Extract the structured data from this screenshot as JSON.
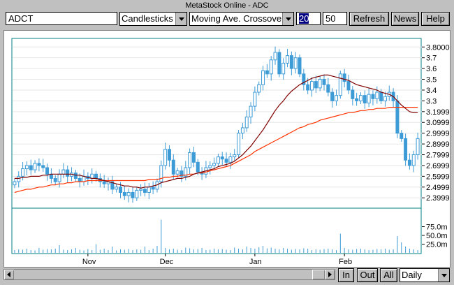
{
  "window": {
    "title": "MetaStock Online - ADC"
  },
  "toolbar": {
    "symbol": "ADCT",
    "chart_type": "Candlesticks",
    "indicator": "Moving Ave. Crossover",
    "param1": "20",
    "param2": "50",
    "refresh_label": "Refresh",
    "news_label": "News",
    "help_label": "Help"
  },
  "bottom": {
    "in_label": "In",
    "out_label": "Out",
    "all_label": "All",
    "period": "Daily"
  },
  "icons": {
    "combo_arrow": "chevron-down-icon",
    "scroll_left": "arrow-left-icon",
    "scroll_right": "arrow-right-icon"
  },
  "colors": {
    "candle": "#3d9bd6",
    "ma_short": "#800000",
    "ma_long": "#ff3300",
    "volume": "#3d9bd6",
    "grid": "#e6e6e6"
  },
  "chart_data": {
    "type": "candlestick",
    "x_ticks": [
      "Nov",
      "Dec",
      "Jan",
      "Feb"
    ],
    "price_ticks": [
      "3.8000",
      "3.7",
      "3.6",
      "3.5",
      "3.4",
      "3.3",
      "3.1999",
      "3.0999",
      "2.9999",
      "2.8999",
      "2.7999",
      "2.6999",
      "2.5999",
      "2.4999",
      "2.3999"
    ],
    "volume_ticks": [
      "75.0m",
      "50.0m",
      "25.0m"
    ],
    "ylim_price": [
      2.33,
      3.86
    ],
    "ylim_volume": [
      0,
      120
    ],
    "grid": true,
    "close": [
      2.55,
      2.6,
      2.67,
      2.7,
      2.66,
      2.72,
      2.7,
      2.68,
      2.62,
      2.58,
      2.55,
      2.62,
      2.66,
      2.6,
      2.63,
      2.58,
      2.55,
      2.6,
      2.58,
      2.62,
      2.58,
      2.55,
      2.53,
      2.55,
      2.48,
      2.5,
      2.45,
      2.42,
      2.45,
      2.4,
      2.47,
      2.48,
      2.45,
      2.5,
      2.48,
      2.55,
      2.7,
      2.85,
      2.75,
      2.62,
      2.65,
      2.6,
      2.68,
      2.82,
      2.73,
      2.64,
      2.62,
      2.68,
      2.7,
      2.72,
      2.78,
      2.76,
      2.73,
      2.78,
      2.8,
      3.0,
      3.05,
      3.15,
      3.25,
      3.38,
      3.45,
      3.58,
      3.55,
      3.68,
      3.75,
      3.55,
      3.65,
      3.72,
      3.6,
      3.7,
      3.55,
      3.45,
      3.4,
      3.48,
      3.42,
      3.5,
      3.45,
      3.38,
      3.3,
      3.35,
      3.55,
      3.48,
      3.4,
      3.32,
      3.3,
      3.35,
      3.28,
      3.36,
      3.32,
      3.38,
      3.3,
      3.34,
      3.38,
      3.3,
      3.0,
      2.95,
      2.75,
      2.7,
      2.8,
      2.95
    ],
    "ma_short": [
      2.58,
      2.58,
      2.59,
      2.59,
      2.6,
      2.6,
      2.6,
      2.61,
      2.61,
      2.62,
      2.62,
      2.62,
      2.62,
      2.62,
      2.62,
      2.61,
      2.61,
      2.6,
      2.59,
      2.58,
      2.58,
      2.57,
      2.56,
      2.55,
      2.54,
      2.53,
      2.52,
      2.51,
      2.51,
      2.5,
      2.5,
      2.49,
      2.5,
      2.5,
      2.51,
      2.52,
      2.54,
      2.55,
      2.56,
      2.57,
      2.58,
      2.58,
      2.59,
      2.6,
      2.62,
      2.63,
      2.64,
      2.65,
      2.66,
      2.67,
      2.69,
      2.7,
      2.71,
      2.72,
      2.74,
      2.77,
      2.8,
      2.84,
      2.88,
      2.93,
      2.98,
      3.03,
      3.09,
      3.15,
      3.21,
      3.26,
      3.3,
      3.35,
      3.39,
      3.42,
      3.45,
      3.47,
      3.49,
      3.51,
      3.52,
      3.53,
      3.54,
      3.54,
      3.53,
      3.52,
      3.51,
      3.5,
      3.49,
      3.47,
      3.45,
      3.44,
      3.43,
      3.42,
      3.41,
      3.4,
      3.38,
      3.37,
      3.36,
      3.34,
      3.3,
      3.26,
      3.23,
      3.2,
      3.19,
      3.19
    ],
    "ma_long": [
      2.45,
      2.46,
      2.47,
      2.48,
      2.48,
      2.49,
      2.5,
      2.5,
      2.51,
      2.52,
      2.52,
      2.53,
      2.53,
      2.54,
      2.54,
      2.55,
      2.55,
      2.55,
      2.56,
      2.56,
      2.56,
      2.56,
      2.56,
      2.56,
      2.56,
      2.56,
      2.56,
      2.56,
      2.56,
      2.56,
      2.56,
      2.56,
      2.56,
      2.57,
      2.57,
      2.57,
      2.58,
      2.59,
      2.59,
      2.6,
      2.6,
      2.61,
      2.61,
      2.62,
      2.62,
      2.63,
      2.63,
      2.64,
      2.65,
      2.66,
      2.67,
      2.68,
      2.69,
      2.7,
      2.72,
      2.74,
      2.76,
      2.78,
      2.8,
      2.83,
      2.85,
      2.87,
      2.89,
      2.91,
      2.93,
      2.95,
      2.97,
      2.99,
      3.01,
      3.03,
      3.05,
      3.06,
      3.08,
      3.09,
      3.1,
      3.12,
      3.13,
      3.14,
      3.15,
      3.16,
      3.17,
      3.18,
      3.19,
      3.19,
      3.2,
      3.21,
      3.21,
      3.22,
      3.22,
      3.23,
      3.23,
      3.23,
      3.24,
      3.24,
      3.24,
      3.24,
      3.24,
      3.24,
      3.24,
      3.24
    ],
    "volume": [
      8,
      10,
      9,
      12,
      8,
      7,
      14,
      9,
      11,
      10,
      12,
      22,
      9,
      8,
      10,
      14,
      9,
      7,
      11,
      8,
      25,
      9,
      12,
      8,
      18,
      7,
      10,
      9,
      11,
      8,
      10,
      9,
      18,
      8,
      12,
      20,
      95,
      14,
      10,
      12,
      9,
      8,
      15,
      13,
      10,
      11,
      14,
      8,
      9,
      12,
      10,
      11,
      9,
      8,
      15,
      12,
      10,
      18,
      14,
      12,
      16,
      20,
      13,
      15,
      12,
      10,
      14,
      12,
      9,
      11,
      10,
      13,
      12,
      8,
      10,
      9,
      11,
      12,
      10,
      8,
      55,
      14,
      10,
      9,
      11,
      12,
      10,
      8,
      9,
      11,
      10,
      12,
      9,
      10,
      48,
      30,
      18,
      12,
      10,
      8
    ]
  }
}
